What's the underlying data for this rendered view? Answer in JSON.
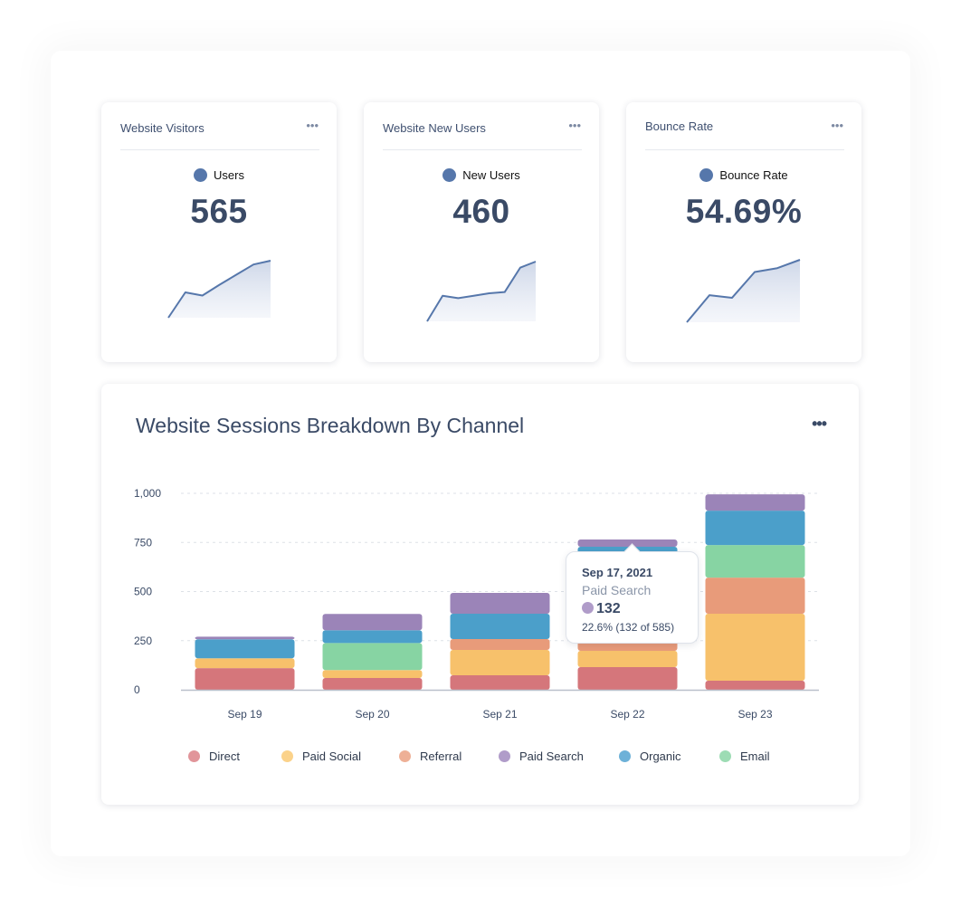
{
  "kpi_cards": [
    {
      "title": "Website Visitors",
      "menu_icon": "more-horizontal-icon",
      "legend_label": "Users",
      "value": "565",
      "sparkline": [
        0,
        40,
        35,
        52,
        68,
        84,
        90
      ],
      "color": "#5677ab"
    },
    {
      "title": "Website New Users",
      "menu_icon": "more-horizontal-icon",
      "legend_label": "New Users",
      "value": "460",
      "sparkline": [
        0,
        42,
        38,
        42,
        46,
        48,
        88,
        98
      ],
      "color": "#5677ab"
    },
    {
      "title": "Bounce Rate",
      "menu_icon": "more-horizontal-icon",
      "legend_label": "Bounce Rate",
      "value": "54.69%",
      "sparkline": [
        0,
        42,
        38,
        78,
        84,
        97
      ],
      "color": "#5677ab"
    }
  ],
  "main_card": {
    "title": "Website Sessions Breakdown By Channel",
    "menu_icon": "more-horizontal-icon"
  },
  "chart_data": {
    "type": "bar",
    "stacked": true,
    "title": "Website Sessions Breakdown By Channel",
    "xlabel": "",
    "ylabel": "",
    "ylim": [
      0,
      1000
    ],
    "yticks": [
      0,
      250,
      500,
      750,
      1000
    ],
    "ytick_labels": [
      "0",
      "250",
      "500",
      "750",
      "1,000"
    ],
    "grid": true,
    "legend_position": "bottom",
    "categories": [
      "Sep 19",
      "Sep 20",
      "Sep 21",
      "Sep 22",
      "Sep 23"
    ],
    "series": [
      {
        "name": "Direct",
        "color": "#d5767b",
        "values": [
          110,
          60,
          74,
          115,
          46
        ]
      },
      {
        "name": "Paid Social",
        "color": "#f7c16b",
        "values": [
          50,
          40,
          129,
          83,
          341
        ]
      },
      {
        "name": "Referral",
        "color": "#e89b7a",
        "values": [
          0,
          0,
          55,
          150,
          184
        ]
      },
      {
        "name": "Email",
        "color": "#87d4a3",
        "values": [
          0,
          138,
          0,
          0,
          166
        ]
      },
      {
        "name": "Organic",
        "color": "#4b9fca",
        "values": [
          97,
          65,
          129,
          380,
          175
        ]
      },
      {
        "name": "Paid Search",
        "color": "#9b84b8",
        "values": [
          13,
          83,
          106,
          37,
          83
        ]
      }
    ],
    "legend": [
      {
        "name": "Direct",
        "color": "#e1959a"
      },
      {
        "name": "Paid Social",
        "color": "#fbd28a"
      },
      {
        "name": "Referral",
        "color": "#eeb096"
      },
      {
        "name": "Paid Search",
        "color": "#b09cc9"
      },
      {
        "name": "Organic",
        "color": "#6db1d8"
      },
      {
        "name": "Email",
        "color": "#9ddcb4"
      }
    ],
    "tooltip": {
      "date": "Sep 17, 2021",
      "series": "Paid Search",
      "value": "132",
      "detail": "22.6% (132 of 585)",
      "color": "#b09cc9",
      "category": "Sep 22"
    }
  }
}
